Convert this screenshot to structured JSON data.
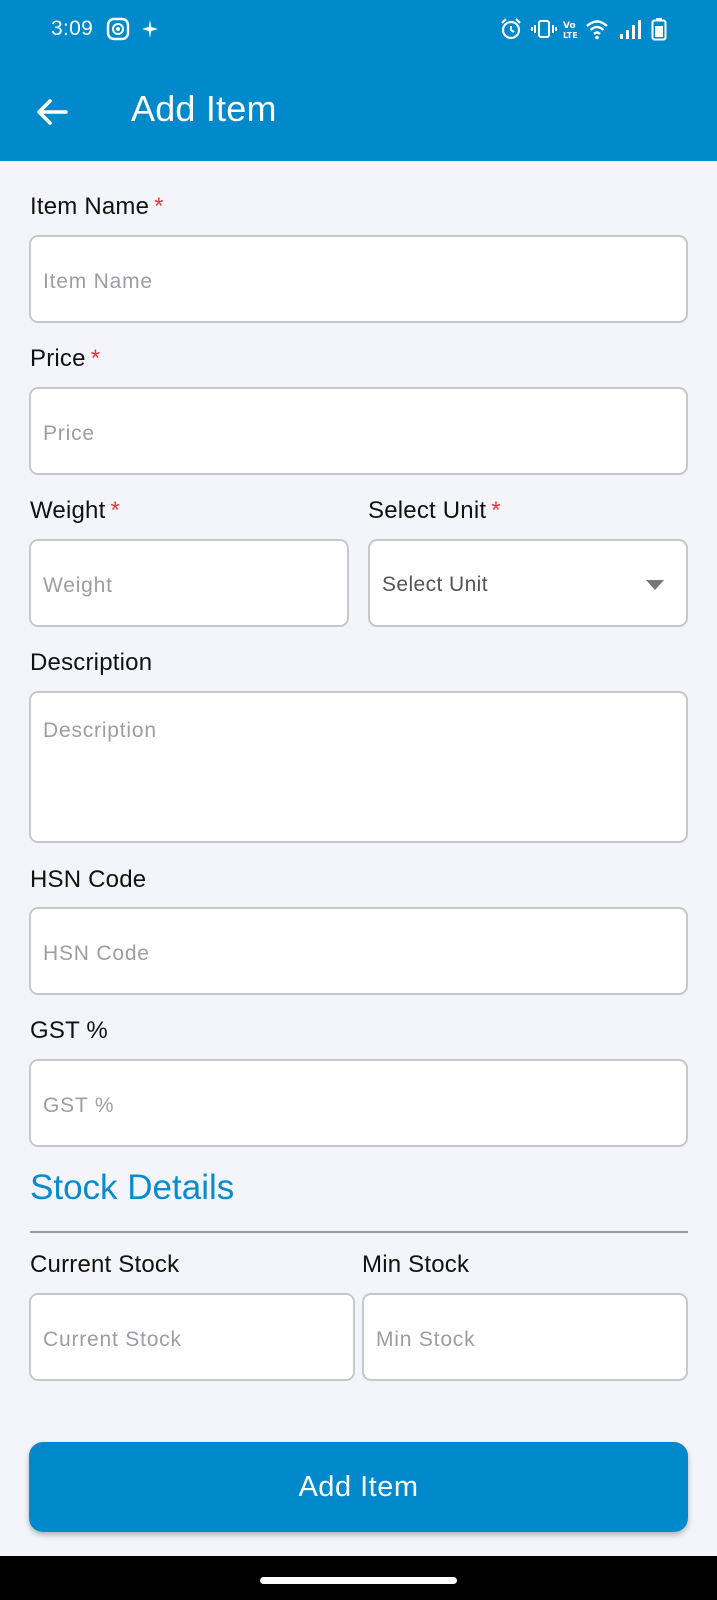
{
  "status_bar": {
    "time": "3:09",
    "left_icons": [
      "screen-record-icon",
      "sparkle-icon"
    ],
    "right_icons": [
      "alarm-icon",
      "vibrate-icon",
      "volte-icon",
      "wifi-icon",
      "signal-icon",
      "battery-icon"
    ]
  },
  "header": {
    "title": "Add Item",
    "back_icon": "arrow-left-icon"
  },
  "form": {
    "item_name": {
      "label": "Item Name",
      "required_mark": "*",
      "placeholder": "Item Name"
    },
    "price": {
      "label": "Price",
      "required_mark": "*",
      "placeholder": "Price"
    },
    "weight": {
      "label": "Weight",
      "required_mark": "*",
      "placeholder": "Weight"
    },
    "unit": {
      "label": "Select Unit",
      "required_mark": "*",
      "selected": "Select Unit"
    },
    "description": {
      "label": "Description",
      "placeholder": "Description"
    },
    "hsn": {
      "label": "HSN Code",
      "placeholder": "HSN Code"
    },
    "gst": {
      "label": "GST %",
      "placeholder": "GST %"
    }
  },
  "stock": {
    "section_title": "Stock Details",
    "current": {
      "label": "Current Stock",
      "placeholder": "Current Stock"
    },
    "min": {
      "label": "Min Stock",
      "placeholder": "Min Stock"
    }
  },
  "submit_label": "Add Item",
  "colors": {
    "primary": "#0089cb",
    "required": "#e23b3b",
    "background": "#f4f5fa"
  }
}
